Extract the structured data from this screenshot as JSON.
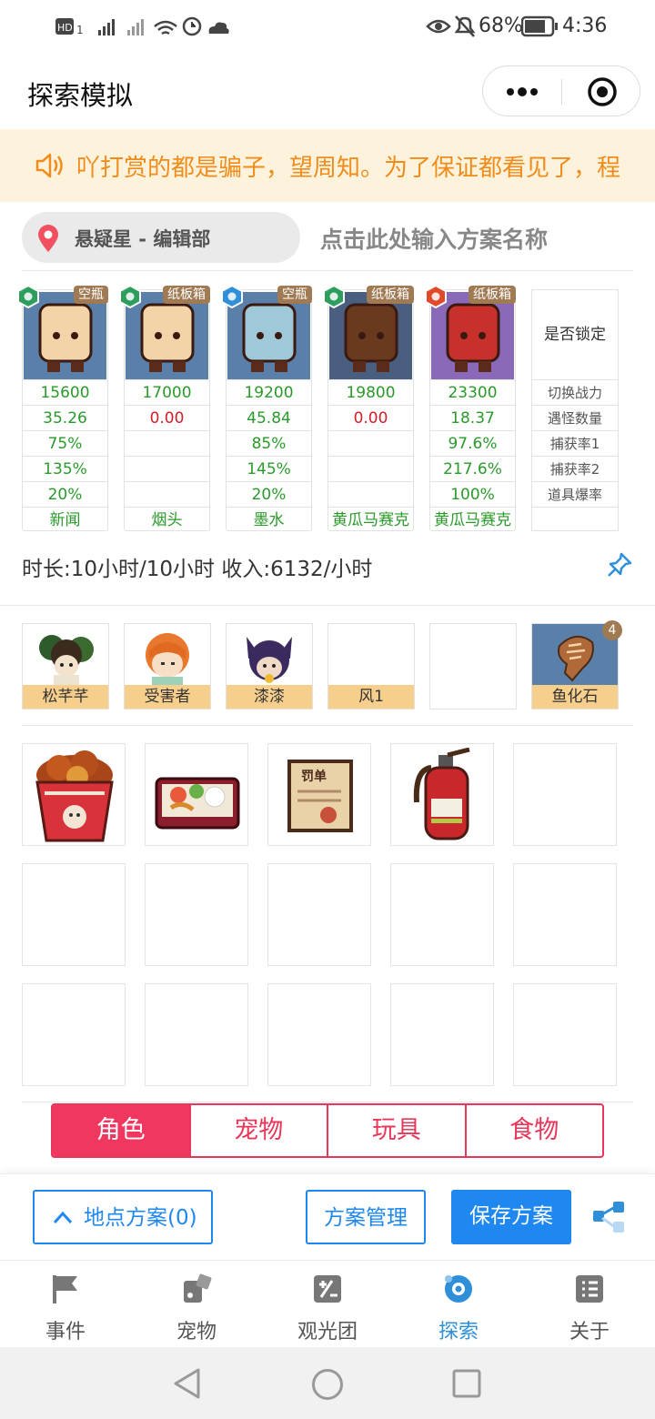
{
  "status": {
    "battery_pct": "68%",
    "time": "4:36",
    "network": "4G"
  },
  "header": {
    "title": "探索模拟"
  },
  "notice": {
    "text": "吖打赏的都是骗子，望周知。为了保证都看见了，程"
  },
  "location": {
    "name": "悬疑星 - 编辑部",
    "plan_placeholder": "点击此处输入方案名称"
  },
  "cards": [
    {
      "tag": "空瓶",
      "power": "15600",
      "count": "35.26",
      "rate1": "75%",
      "rate2": "135%",
      "drop": "20%",
      "item": "新闻",
      "color": "#2e9e5e"
    },
    {
      "tag": "纸板箱",
      "power": "17000",
      "count": "0.00",
      "rate1": "",
      "rate2": "",
      "drop": "",
      "item": "烟头",
      "color": "#2e9e5e"
    },
    {
      "tag": "空瓶",
      "power": "19200",
      "count": "45.84",
      "rate1": "85%",
      "rate2": "145%",
      "drop": "20%",
      "item": "墨水",
      "color": "#2f8fd8"
    },
    {
      "tag": "纸板箱",
      "power": "19800",
      "count": "0.00",
      "rate1": "",
      "rate2": "",
      "drop": "",
      "item": "黄瓜马赛克",
      "color": "#2e9e5e"
    },
    {
      "tag": "纸板箱",
      "power": "23300",
      "count": "18.37",
      "rate1": "97.6%",
      "rate2": "217.6%",
      "drop": "100%",
      "item": "黄瓜马赛克",
      "color": "#e04a2a"
    }
  ],
  "labels": {
    "lock": "是否锁定",
    "power": "切换战力",
    "count": "遇怪数量",
    "rate1": "捕获率1",
    "rate2": "捕获率2",
    "drop": "道具爆率"
  },
  "summary": "时长:10小时/10小时 收入:6132/小时",
  "party": [
    {
      "name": "松芊芊"
    },
    {
      "name": "受害者"
    },
    {
      "name": "漆漆"
    },
    {
      "name": "风1"
    },
    {
      "name": ""
    },
    {
      "name": "鱼化石",
      "badge": "4"
    }
  ],
  "items": [
    "fried-chicken-bucket",
    "bento-box",
    "ticket-document",
    "fire-extinguisher"
  ],
  "tabs": [
    {
      "label": "角色"
    },
    {
      "label": "宠物"
    },
    {
      "label": "玩具"
    },
    {
      "label": "食物"
    }
  ],
  "actions": {
    "location_plans": "地点方案(0)",
    "manage": "方案管理",
    "save": "保存方案"
  },
  "nav": [
    {
      "label": "事件"
    },
    {
      "label": "宠物"
    },
    {
      "label": "观光团"
    },
    {
      "label": "探索",
      "active": true
    },
    {
      "label": "关于"
    }
  ],
  "colors": {
    "accent_blue": "#1e88f0",
    "tab_red": "#f0375f",
    "value_green": "#2a9a2a",
    "value_red": "#d0202a",
    "notice_orange": "#f08c1b"
  }
}
